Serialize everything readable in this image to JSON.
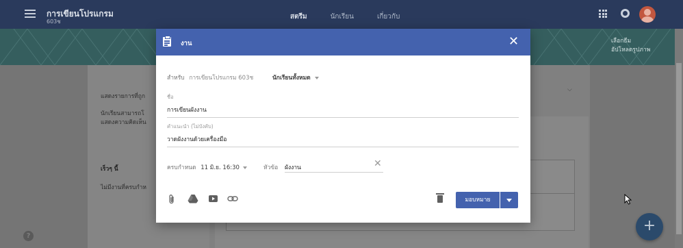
{
  "topbar": {
    "class_title": "การเขียนโปรแกรม",
    "class_sub": "603ช",
    "tabs": [
      "สตรีม",
      "นักเรียน",
      "เกี่ยวกับ"
    ]
  },
  "banner": {
    "select_theme": "เลือกธีม",
    "upload_photo": "อัปโหลดรูปภาพ"
  },
  "background": {
    "show_items_truncated": "แสดงรายการที่ถูก",
    "students_can_truncated": "นักเรียนสามารถโ",
    "show_comments_truncated": "แสดงความคิดเห็น",
    "upcoming_title": "เร็วๆ นี้",
    "no_work_truncated": "ไม่มีงานที่ครบกำห"
  },
  "dialog": {
    "title": "งาน",
    "for_label": "สำหรับ",
    "class_name": "การเขียนโปรแกรม 603ช",
    "students_select": "นักเรียนทั้งหมด",
    "title_field_label": "ชื่อ",
    "title_field_value": "การเขียนผังงาน",
    "instructions_label": "คำแนะนำ (ไม่บังคับ)",
    "instructions_value": "วาดผังงานด้วยเครื่องมือ",
    "due_label": "ครบกำหนด",
    "due_value": "11 มิ.ย. 16:30",
    "topic_label": "หัวข้อ",
    "topic_value": "ผังงาน",
    "assign_button": "มอบหมาย"
  },
  "colors": {
    "dialog_header": "#4462ae",
    "topbar": "#2a3a5c",
    "banner": "#355e5e"
  },
  "icons": [
    "menu-icon",
    "apps-icon",
    "notifications-icon",
    "assignment-icon",
    "close-icon",
    "attach-icon",
    "drive-icon",
    "youtube-icon",
    "link-icon",
    "delete-icon",
    "help-icon",
    "add-icon"
  ]
}
